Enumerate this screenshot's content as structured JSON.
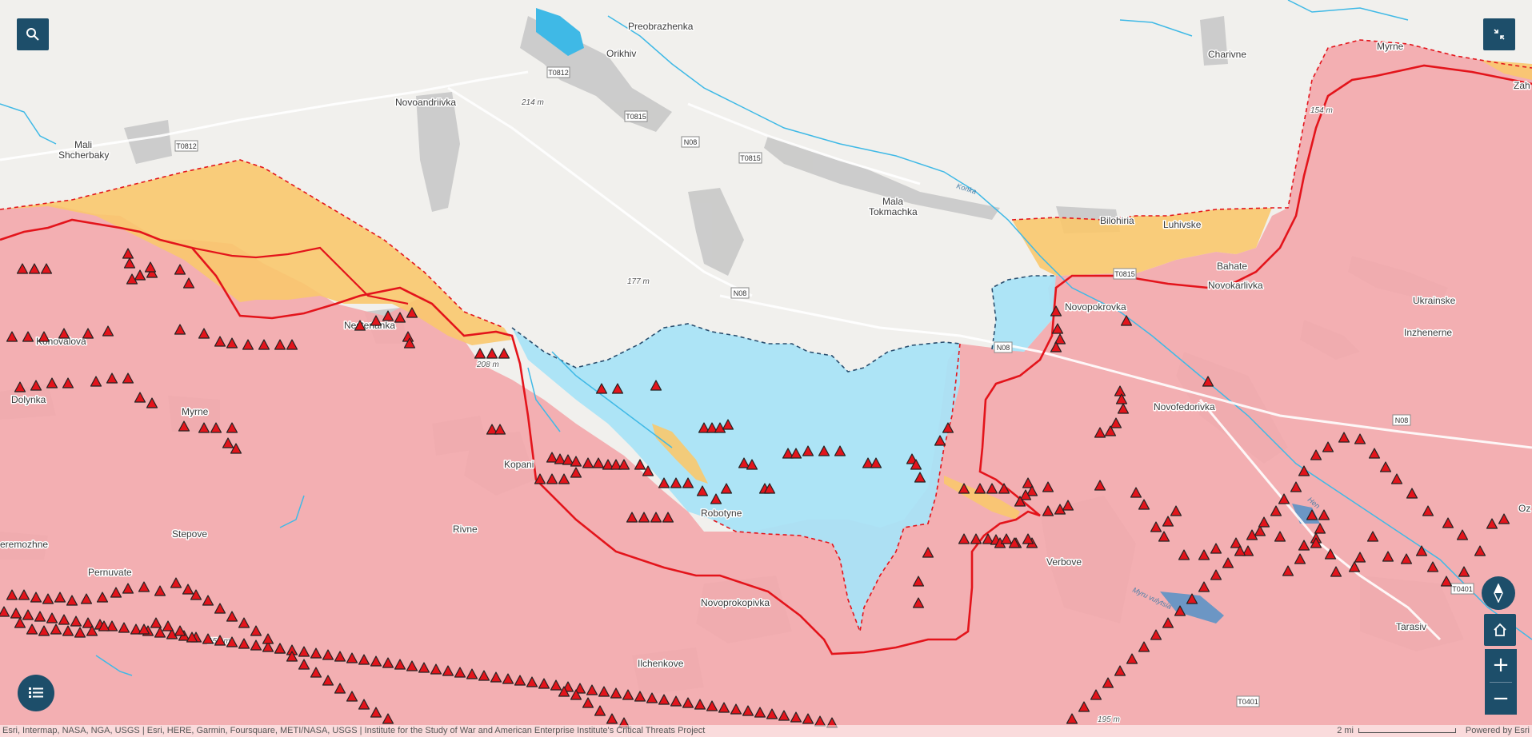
{
  "places": [
    {
      "id": "preobrazhenka",
      "label": "Preobrazhenka"
    },
    {
      "id": "orikhiv",
      "label": "Orikhiv"
    },
    {
      "id": "novoandriivka",
      "label": "Novoandriivka"
    },
    {
      "id": "mali-shcherbaky",
      "label": "Mali"
    },
    {
      "id": "mali-shcherbaky-2",
      "label": "Shcherbaky"
    },
    {
      "id": "charivne",
      "label": "Charivne"
    },
    {
      "id": "myrne-ne",
      "label": "Myrne"
    },
    {
      "id": "zah",
      "label": "Zah"
    },
    {
      "id": "mala-tokmachka",
      "label": "Mala"
    },
    {
      "id": "mala-tokmachka-2",
      "label": "Tokmachka"
    },
    {
      "id": "bilohiria",
      "label": "Bilohiria"
    },
    {
      "id": "luhivske",
      "label": "Luhivske"
    },
    {
      "id": "bahate",
      "label": "Bahate"
    },
    {
      "id": "novokarlivka",
      "label": "Novokarlivka"
    },
    {
      "id": "ukrainske",
      "label": "Ukrainske"
    },
    {
      "id": "novopokrovka",
      "label": "Novopokrovka"
    },
    {
      "id": "inzhenerne",
      "label": "Inzhenerne"
    },
    {
      "id": "konovalova",
      "label": "Konovalova"
    },
    {
      "id": "nesterianka",
      "label": "Nesterianka"
    },
    {
      "id": "dolynka",
      "label": "Dolynka"
    },
    {
      "id": "myrne-w",
      "label": "Myrne"
    },
    {
      "id": "novofedorivka",
      "label": "Novofedorivka"
    },
    {
      "id": "kopani",
      "label": "Kopani"
    },
    {
      "id": "robotyne",
      "label": "Robotyne"
    },
    {
      "id": "rivne",
      "label": "Rivne"
    },
    {
      "id": "stepove",
      "label": "Stepove"
    },
    {
      "id": "verbove",
      "label": "Verbove"
    },
    {
      "id": "oz",
      "label": "Oz"
    },
    {
      "id": "neremozhne",
      "label": "eremozhne"
    },
    {
      "id": "pernuvate",
      "label": "Pernuvate"
    },
    {
      "id": "novoprokopivka",
      "label": "Novoprokopivka"
    },
    {
      "id": "tarasivka",
      "label": "Tarasiv"
    },
    {
      "id": "ilchenkove",
      "label": "Ilchenkove"
    }
  ],
  "elevations": [
    "214 m",
    "177 m",
    "208 m",
    "154 m",
    "156 m",
    "195 m"
  ],
  "rivers": [
    "Konka",
    "Myru vulytsia",
    "Hen"
  ],
  "roads": [
    "T0812",
    "T0815",
    "N08",
    "T0812",
    "T0815",
    "N08",
    "T0815",
    "N08",
    "N08",
    "T0401",
    "T0401"
  ],
  "legend": {
    "colors": {
      "russian_control": "#f3a9ad",
      "ukrainian_advance": "#a9e3f7",
      "contested": "#f9c86d",
      "frontline": "#e3141b",
      "fortification": "#e3141b"
    }
  },
  "controls": {
    "search_icon": "search-icon",
    "exit_fullscreen_icon": "exit-fullscreen-icon",
    "legend_icon": "list-icon",
    "compass_icon": "compass-icon",
    "home_icon": "home-icon",
    "zoom_in": "+",
    "zoom_out": "−"
  },
  "attribution": {
    "sources": "Esri, Intermap, NASA, NGA, USGS | Esri, HERE, Garmin, Foursquare, METI/NASA, USGS | Institute for the Study of War and American Enterprise Institute's Critical Threats Project",
    "scale_label": "2 mi",
    "powered_by": "Powered by Esri"
  }
}
